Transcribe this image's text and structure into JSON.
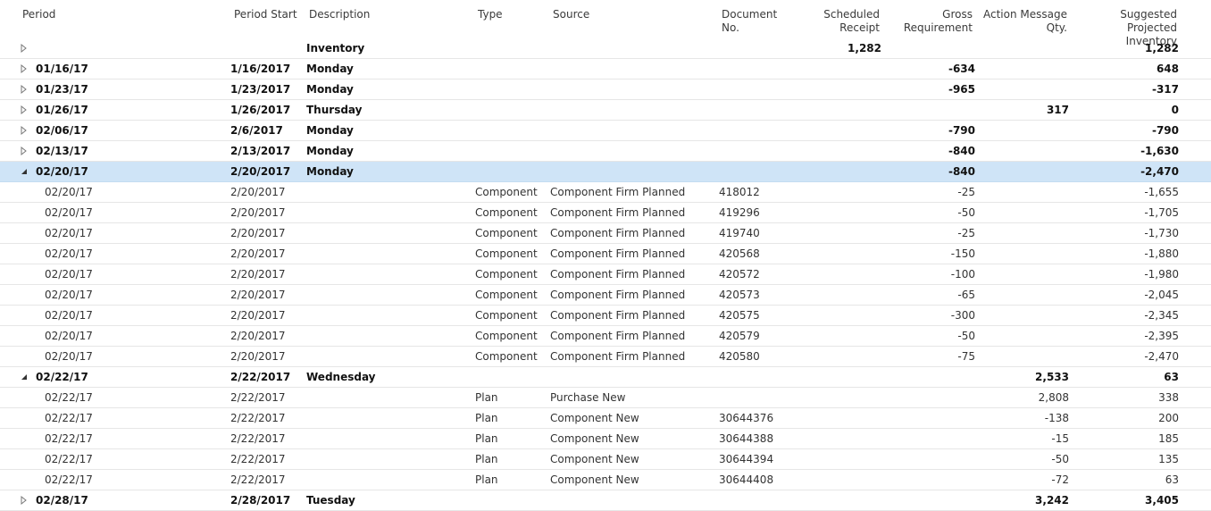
{
  "columns": {
    "period": "Period",
    "period_start": "Period Start",
    "description": "Description",
    "type": "Type",
    "source": "Source",
    "document_no": [
      "Document",
      "No."
    ],
    "scheduled_receipt": [
      "Scheduled",
      "Receipt"
    ],
    "gross_requirement": [
      "Gross",
      "Requirement"
    ],
    "action_message_qty": [
      "Action Message",
      "Qty."
    ],
    "suggested_projected_inventory": [
      "Suggested Projected",
      "Inventory"
    ]
  },
  "rows": [
    {
      "kind": "group",
      "expander": "collapsed",
      "period": "",
      "period_start": "",
      "description": "Inventory",
      "type": "",
      "source": "",
      "document_no": "",
      "scheduled_receipt": "1,282",
      "gross_requirement": "",
      "action_message_qty": "",
      "projected": "1,282"
    },
    {
      "kind": "group",
      "expander": "collapsed",
      "period": "01/16/17",
      "period_start": "1/16/2017",
      "description": "Monday",
      "type": "",
      "source": "",
      "document_no": "",
      "scheduled_receipt": "",
      "gross_requirement": "-634",
      "action_message_qty": "",
      "projected": "648"
    },
    {
      "kind": "group",
      "expander": "collapsed",
      "period": "01/23/17",
      "period_start": "1/23/2017",
      "description": "Monday",
      "type": "",
      "source": "",
      "document_no": "",
      "scheduled_receipt": "",
      "gross_requirement": "-965",
      "action_message_qty": "",
      "projected": "-317"
    },
    {
      "kind": "group",
      "expander": "collapsed",
      "period": "01/26/17",
      "period_start": "1/26/2017",
      "description": "Thursday",
      "type": "",
      "source": "",
      "document_no": "",
      "scheduled_receipt": "",
      "gross_requirement": "",
      "action_message_qty": "317",
      "projected": "0"
    },
    {
      "kind": "group",
      "expander": "collapsed",
      "period": "02/06/17",
      "period_start": "2/6/2017",
      "description": "Monday",
      "type": "",
      "source": "",
      "document_no": "",
      "scheduled_receipt": "",
      "gross_requirement": "-790",
      "action_message_qty": "",
      "projected": "-790"
    },
    {
      "kind": "group",
      "expander": "collapsed",
      "period": "02/13/17",
      "period_start": "2/13/2017",
      "description": "Monday",
      "type": "",
      "source": "",
      "document_no": "",
      "scheduled_receipt": "",
      "gross_requirement": "-840",
      "action_message_qty": "",
      "projected": "-1,630"
    },
    {
      "kind": "group",
      "expander": "expanded",
      "selected": true,
      "period": "02/20/17",
      "period_start": "2/20/2017",
      "description": "Monday",
      "type": "",
      "source": "",
      "document_no": "",
      "scheduled_receipt": "",
      "gross_requirement": "-840",
      "action_message_qty": "",
      "projected": "-2,470"
    },
    {
      "kind": "detail",
      "period": "02/20/17",
      "period_start": "2/20/2017",
      "description": "",
      "type": "Component",
      "source": "Component Firm Planned",
      "document_no": "418012",
      "scheduled_receipt": "",
      "gross_requirement": "-25",
      "action_message_qty": "",
      "projected": "-1,655"
    },
    {
      "kind": "detail",
      "period": "02/20/17",
      "period_start": "2/20/2017",
      "description": "",
      "type": "Component",
      "source": "Component Firm Planned",
      "document_no": "419296",
      "scheduled_receipt": "",
      "gross_requirement": "-50",
      "action_message_qty": "",
      "projected": "-1,705"
    },
    {
      "kind": "detail",
      "period": "02/20/17",
      "period_start": "2/20/2017",
      "description": "",
      "type": "Component",
      "source": "Component Firm Planned",
      "document_no": "419740",
      "scheduled_receipt": "",
      "gross_requirement": "-25",
      "action_message_qty": "",
      "projected": "-1,730"
    },
    {
      "kind": "detail",
      "period": "02/20/17",
      "period_start": "2/20/2017",
      "description": "",
      "type": "Component",
      "source": "Component Firm Planned",
      "document_no": "420568",
      "scheduled_receipt": "",
      "gross_requirement": "-150",
      "action_message_qty": "",
      "projected": "-1,880"
    },
    {
      "kind": "detail",
      "period": "02/20/17",
      "period_start": "2/20/2017",
      "description": "",
      "type": "Component",
      "source": "Component Firm Planned",
      "document_no": "420572",
      "scheduled_receipt": "",
      "gross_requirement": "-100",
      "action_message_qty": "",
      "projected": "-1,980"
    },
    {
      "kind": "detail",
      "period": "02/20/17",
      "period_start": "2/20/2017",
      "description": "",
      "type": "Component",
      "source": "Component Firm Planned",
      "document_no": "420573",
      "scheduled_receipt": "",
      "gross_requirement": "-65",
      "action_message_qty": "",
      "projected": "-2,045"
    },
    {
      "kind": "detail",
      "period": "02/20/17",
      "period_start": "2/20/2017",
      "description": "",
      "type": "Component",
      "source": "Component Firm Planned",
      "document_no": "420575",
      "scheduled_receipt": "",
      "gross_requirement": "-300",
      "action_message_qty": "",
      "projected": "-2,345"
    },
    {
      "kind": "detail",
      "period": "02/20/17",
      "period_start": "2/20/2017",
      "description": "",
      "type": "Component",
      "source": "Component Firm Planned",
      "document_no": "420579",
      "scheduled_receipt": "",
      "gross_requirement": "-50",
      "action_message_qty": "",
      "projected": "-2,395"
    },
    {
      "kind": "detail",
      "period": "02/20/17",
      "period_start": "2/20/2017",
      "description": "",
      "type": "Component",
      "source": "Component Firm Planned",
      "document_no": "420580",
      "scheduled_receipt": "",
      "gross_requirement": "-75",
      "action_message_qty": "",
      "projected": "-2,470"
    },
    {
      "kind": "group",
      "expander": "expanded",
      "period": "02/22/17",
      "period_start": "2/22/2017",
      "description": "Wednesday",
      "type": "",
      "source": "",
      "document_no": "",
      "scheduled_receipt": "",
      "gross_requirement": "",
      "action_message_qty": "2,533",
      "projected": "63"
    },
    {
      "kind": "detail",
      "period": "02/22/17",
      "period_start": "2/22/2017",
      "description": "",
      "type": "Plan",
      "source": "Purchase New",
      "document_no": "",
      "scheduled_receipt": "",
      "gross_requirement": "",
      "action_message_qty": "2,808",
      "projected": "338"
    },
    {
      "kind": "detail",
      "period": "02/22/17",
      "period_start": "2/22/2017",
      "description": "",
      "type": "Plan",
      "source": "Component New",
      "document_no": "30644376",
      "scheduled_receipt": "",
      "gross_requirement": "",
      "action_message_qty": "-138",
      "projected": "200"
    },
    {
      "kind": "detail",
      "period": "02/22/17",
      "period_start": "2/22/2017",
      "description": "",
      "type": "Plan",
      "source": "Component New",
      "document_no": "30644388",
      "scheduled_receipt": "",
      "gross_requirement": "",
      "action_message_qty": "-15",
      "projected": "185"
    },
    {
      "kind": "detail",
      "period": "02/22/17",
      "period_start": "2/22/2017",
      "description": "",
      "type": "Plan",
      "source": "Component New",
      "document_no": "30644394",
      "scheduled_receipt": "",
      "gross_requirement": "",
      "action_message_qty": "-50",
      "projected": "135"
    },
    {
      "kind": "detail",
      "period": "02/22/17",
      "period_start": "2/22/2017",
      "description": "",
      "type": "Plan",
      "source": "Component New",
      "document_no": "30644408",
      "scheduled_receipt": "",
      "gross_requirement": "",
      "action_message_qty": "-72",
      "projected": "63"
    },
    {
      "kind": "group",
      "expander": "collapsed",
      "period": "02/28/17",
      "period_start": "2/28/2017",
      "description": "Tuesday",
      "type": "",
      "source": "",
      "document_no": "",
      "scheduled_receipt": "",
      "gross_requirement": "",
      "action_message_qty": "3,242",
      "projected": "3,405"
    }
  ]
}
